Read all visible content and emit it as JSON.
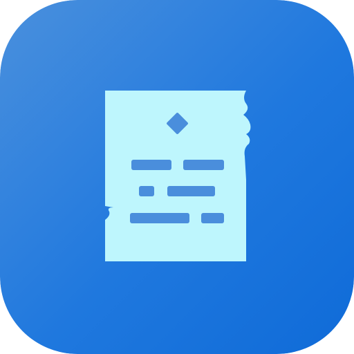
{
  "icon": {
    "name": "document-scroll-icon",
    "background_gradient": [
      "#4a90dd",
      "#1f78de",
      "#0f6bd8"
    ],
    "paper_color": "#bef6fd",
    "mark_color": "#4a8edc"
  }
}
